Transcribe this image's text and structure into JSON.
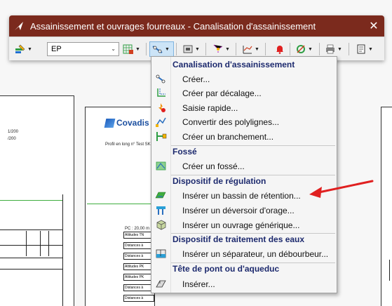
{
  "window": {
    "title": "Assainissement et ouvrages fourreaux - Canalisation d'assainissement",
    "close_glyph": "✕"
  },
  "toolbar": {
    "layer_combo_value": "EP"
  },
  "drawing": {
    "left_sheet": {
      "line1": "1/200",
      "line2": "/200"
    },
    "company": "Covadis",
    "profile_caption": "Profil en long n° Test SK",
    "table_header": "PC : 20,00 m",
    "table_rows": [
      "Altitudes TN",
      "Distances à",
      "Distances à",
      "Altitudes PK",
      "Altitudes PK",
      "Distances à",
      "Distances à"
    ]
  },
  "menu": {
    "sections": [
      {
        "header": "Canalisation d'assainissement",
        "items": [
          {
            "label": "Créer...",
            "icon": "pipe-create-icon"
          },
          {
            "label": "Créer par décalage...",
            "icon": "offset-icon"
          },
          {
            "label": "Saisie rapide...",
            "icon": "quick-entry-icon"
          },
          {
            "label": "Convertir des polylignes...",
            "icon": "convert-polyline-icon"
          },
          {
            "label": "Créer un branchement...",
            "icon": "branch-icon"
          }
        ]
      },
      {
        "header": "Fossé",
        "items": [
          {
            "label": "Créer un fossé...",
            "icon": "ditch-icon"
          }
        ]
      },
      {
        "header": "Dispositif de régulation",
        "items": [
          {
            "label": "Insérer un bassin de rétention...",
            "icon": "retention-basin-icon"
          },
          {
            "label": "Insérer un déversoir d'orage...",
            "icon": "storm-overflow-icon"
          },
          {
            "label": "Insérer un ouvrage générique...",
            "icon": "generic-structure-icon"
          }
        ]
      },
      {
        "header": "Dispositif de traitement des eaux",
        "items": [
          {
            "label": "Insérer un séparateur, un débourbeur...",
            "icon": "separator-icon"
          }
        ]
      },
      {
        "header": "Tête de pont ou d'aqueduc",
        "items": [
          {
            "label": "Insérer...",
            "icon": "bridge-head-icon"
          }
        ]
      }
    ]
  },
  "colors": {
    "titlebar": "#7b2a1d",
    "menu_header": "#1d2a6e",
    "annotation_arrow": "#e02020"
  }
}
